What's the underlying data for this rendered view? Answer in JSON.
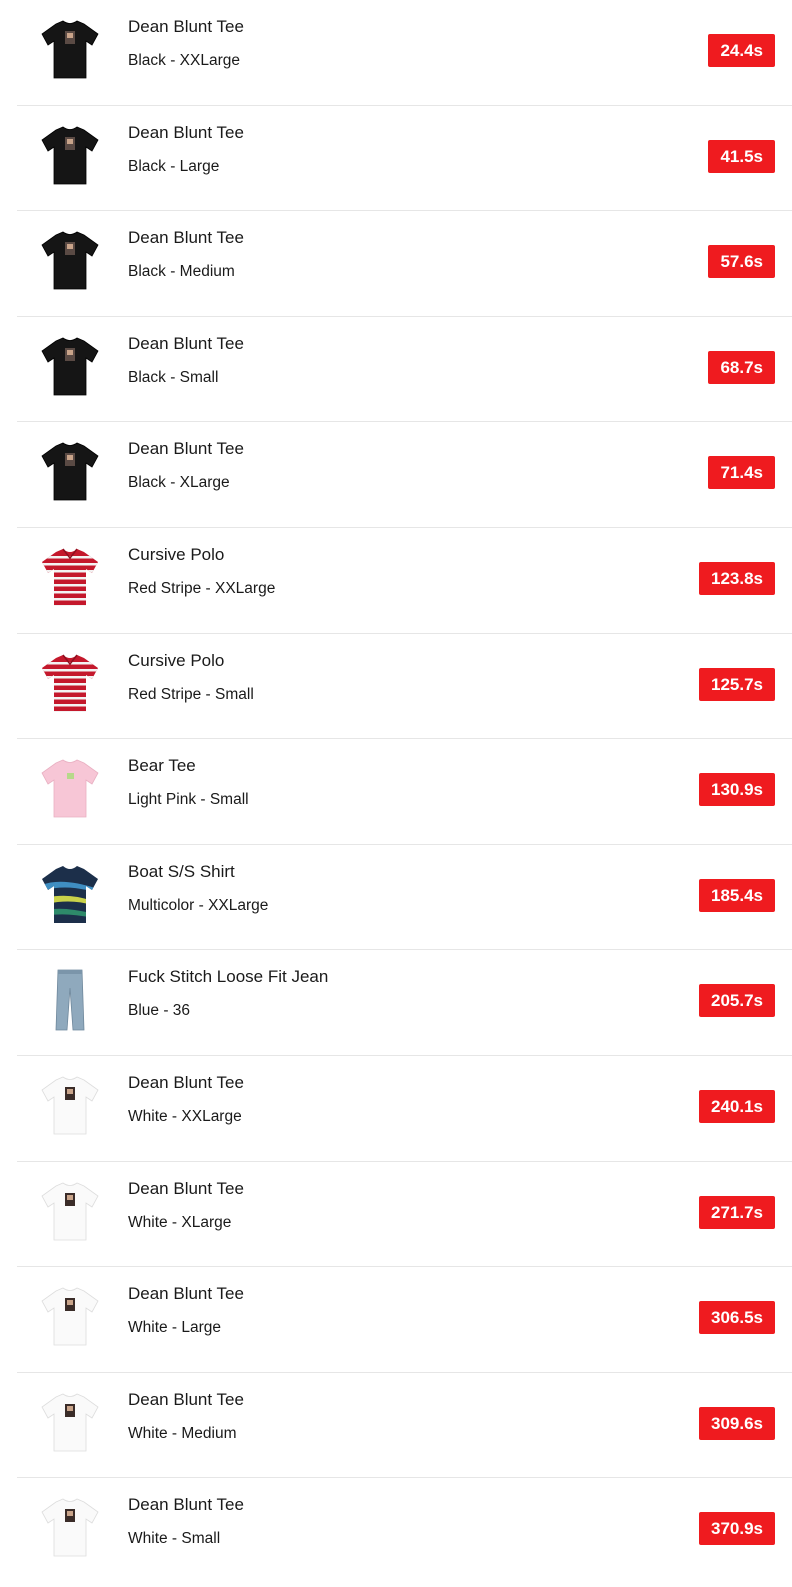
{
  "colors": {
    "badge": "#ef1b1f",
    "divider": "#e6e6e6"
  },
  "items": [
    {
      "name": "Dean Blunt Tee",
      "variant": "Black - XXLarge",
      "time": "24.4s",
      "image": "black-tee"
    },
    {
      "name": "Dean Blunt Tee",
      "variant": "Black - Large",
      "time": "41.5s",
      "image": "black-tee"
    },
    {
      "name": "Dean Blunt Tee",
      "variant": "Black - Medium",
      "time": "57.6s",
      "image": "black-tee"
    },
    {
      "name": "Dean Blunt Tee",
      "variant": "Black - Small",
      "time": "68.7s",
      "image": "black-tee"
    },
    {
      "name": "Dean Blunt Tee",
      "variant": "Black - XLarge",
      "time": "71.4s",
      "image": "black-tee"
    },
    {
      "name": "Cursive Polo",
      "variant": "Red Stripe - XXLarge",
      "time": "123.8s",
      "image": "red-stripe-polo"
    },
    {
      "name": "Cursive Polo",
      "variant": "Red Stripe - Small",
      "time": "125.7s",
      "image": "red-stripe-polo"
    },
    {
      "name": "Bear Tee",
      "variant": "Light Pink - Small",
      "time": "130.9s",
      "image": "pink-tee"
    },
    {
      "name": "Boat S/S Shirt",
      "variant": "Multicolor - XXLarge",
      "time": "185.4s",
      "image": "multicolor-shirt"
    },
    {
      "name": "Fuck Stitch Loose Fit Jean",
      "variant": "Blue - 36",
      "time": "205.7s",
      "image": "blue-jeans"
    },
    {
      "name": "Dean Blunt Tee",
      "variant": "White - XXLarge",
      "time": "240.1s",
      "image": "white-tee"
    },
    {
      "name": "Dean Blunt Tee",
      "variant": "White - XLarge",
      "time": "271.7s",
      "image": "white-tee"
    },
    {
      "name": "Dean Blunt Tee",
      "variant": "White - Large",
      "time": "306.5s",
      "image": "white-tee"
    },
    {
      "name": "Dean Blunt Tee",
      "variant": "White - Medium",
      "time": "309.6s",
      "image": "white-tee"
    },
    {
      "name": "Dean Blunt Tee",
      "variant": "White - Small",
      "time": "370.9s",
      "image": "white-tee"
    }
  ]
}
